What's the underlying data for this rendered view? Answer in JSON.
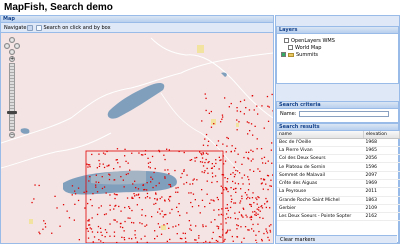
{
  "app": {
    "title": "MapFish, Search demo"
  },
  "map": {
    "header": "Map",
    "toolbar": {
      "navigate_label": "Navigate",
      "search_label": "Search on click and by box"
    }
  },
  "layers": {
    "header": "Layers",
    "items": [
      {
        "label": "OpenLayers WMS",
        "checked": false
      },
      {
        "label": "World Map",
        "checked": false
      },
      {
        "label": "Summits",
        "checked": true
      }
    ]
  },
  "criteria": {
    "header": "Search criteria",
    "name_label": "Name:",
    "name_value": ""
  },
  "results": {
    "header": "Search results",
    "columns": [
      "name",
      "elevation"
    ],
    "rows": [
      [
        "Bec de l'Oeille",
        "1968"
      ],
      [
        "La Pierre Vivan",
        "1965"
      ],
      [
        "Col des Deux Soeurs",
        "2056"
      ],
      [
        "Le Plateau de Sornin",
        "1596"
      ],
      [
        "Sommet de Malavail",
        "2097"
      ],
      [
        "Crête des Aiguas",
        "1969"
      ],
      [
        "La Peyrouse",
        "2011"
      ],
      [
        "Grande Roche Saint Michel",
        "1863"
      ],
      [
        "Gerbier",
        "2109"
      ],
      [
        "Les Deux Soeurs - Pointe Sopter",
        "2162"
      ]
    ],
    "clear_label": "Clear markers"
  },
  "colors": {
    "accent": "#99bbe8",
    "panel_bg": "#dfe8f6",
    "marker": "#e00000",
    "lake": "#7f9fbd",
    "land": "#f4e4e4"
  }
}
